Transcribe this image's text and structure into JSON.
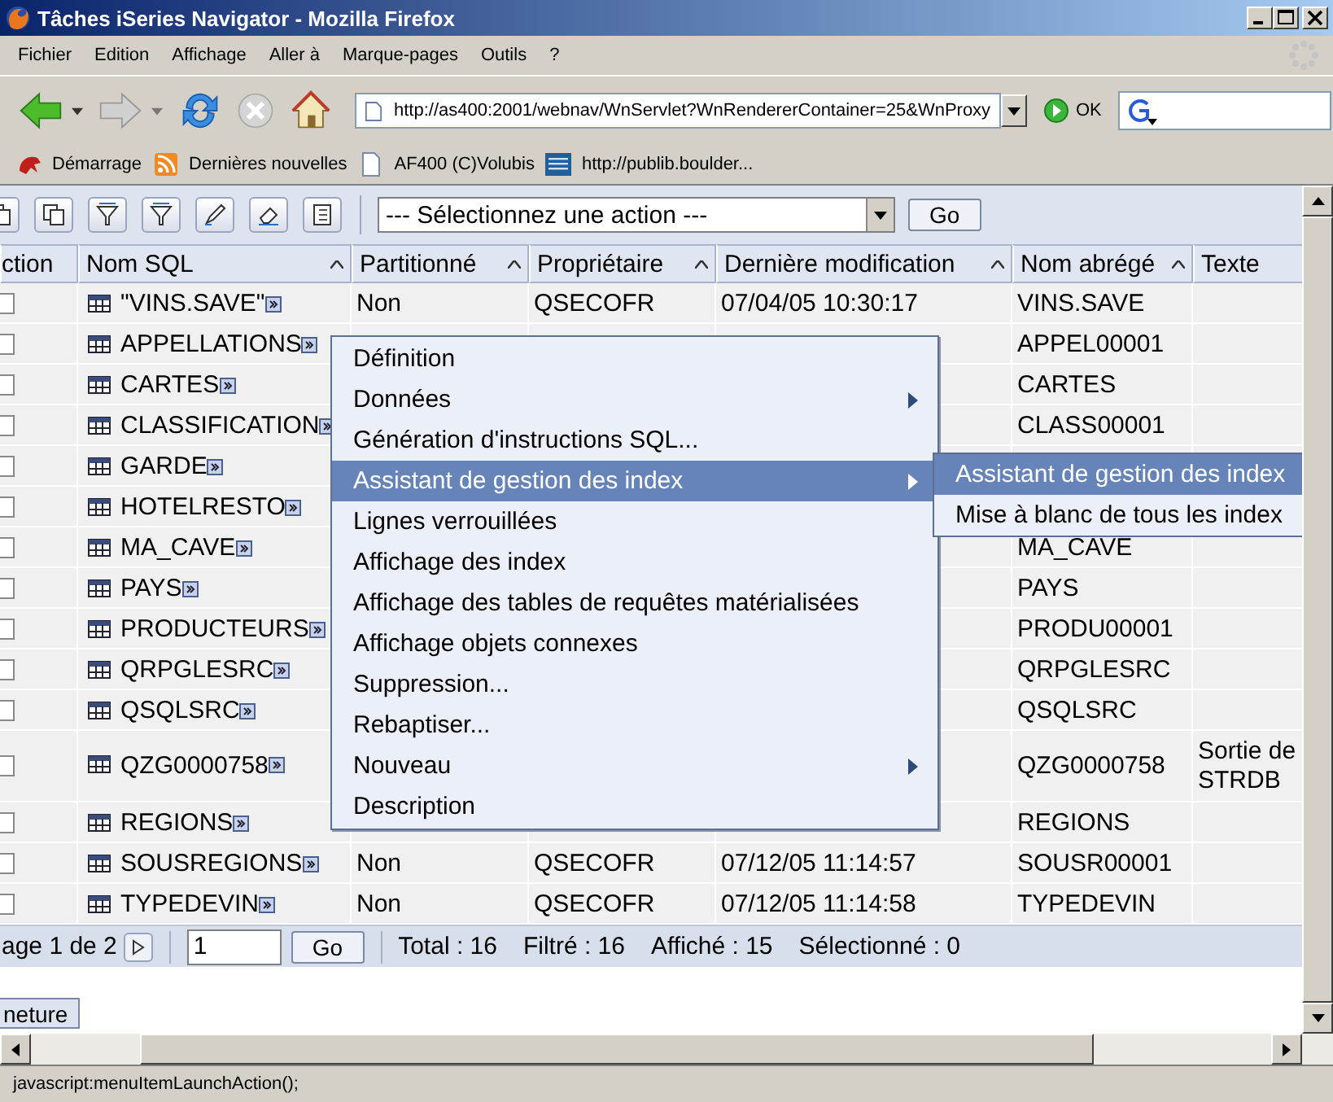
{
  "window": {
    "title": "Tâches iSeries Navigator - Mozilla Firefox"
  },
  "menu_bar": [
    "Fichier",
    "Edition",
    "Affichage",
    "Aller à",
    "Marque-pages",
    "Outils",
    "?"
  ],
  "nav": {
    "url": "http://as400:2001/webnav/WnServlet?WnRendererContainer=25&WnProxy",
    "go": "OK"
  },
  "bookmarks": [
    {
      "kind": "dragon",
      "label": "Démarrage"
    },
    {
      "kind": "rss",
      "label": "Dernières nouvelles"
    },
    {
      "kind": "page",
      "label": "AF400 (C)Volubis"
    },
    {
      "kind": "ibm",
      "label": "http://publib.boulder..."
    }
  ],
  "toolbar": {
    "action_select": "--- Sélectionnez une action ---",
    "go": "Go"
  },
  "table": {
    "columns": [
      {
        "label": "ction",
        "sortable": false
      },
      {
        "label": "Nom SQL",
        "sortable": true
      },
      {
        "label": "Partitionné",
        "sortable": true
      },
      {
        "label": "Propriétaire",
        "sortable": true
      },
      {
        "label": "Dernière modification",
        "sortable": true
      },
      {
        "label": "Nom abrégé",
        "sortable": true
      },
      {
        "label": "Texte",
        "sortable": false
      }
    ],
    "rows": [
      {
        "checked": false,
        "name": "\"VINS.SAVE\"",
        "partitioned": "Non",
        "owner": "QSECOFR",
        "modified": "07/04/05 10:30:17",
        "short_name": "VINS.SAVE"
      },
      {
        "checked": false,
        "name": "APPELLATIONS",
        "short_name": "APPEL00001"
      },
      {
        "checked": false,
        "name": "CARTES",
        "short_name": "CARTES"
      },
      {
        "checked": false,
        "name": "CLASSIFICATION",
        "short_name": "CLASS00001"
      },
      {
        "checked": false,
        "name": "GARDE"
      },
      {
        "checked": false,
        "name": "HOTELRESTO"
      },
      {
        "checked": false,
        "name": "MA_CAVE",
        "short_name": "MA_CAVE"
      },
      {
        "checked": false,
        "name": "PAYS",
        "short_name": "PAYS"
      },
      {
        "checked": false,
        "name": "PRODUCTEURS",
        "short_name": "PRODU00001"
      },
      {
        "checked": false,
        "name": "QRPGLESRC",
        "short_name": "QRPGLESRC"
      },
      {
        "checked": false,
        "name": "QSQLSRC",
        "short_name": "QSQLSRC"
      },
      {
        "checked": false,
        "name": "QZG0000758",
        "short_name": "QZG0000758",
        "text": "Sortie de STRDB"
      },
      {
        "checked": false,
        "name": "REGIONS",
        "short_name": "REGIONS"
      },
      {
        "checked": false,
        "name": "SOUSREGIONS",
        "partitioned": "Non",
        "owner": "QSECOFR",
        "modified": "07/12/05 11:14:57",
        "short_name": "SOUSR00001"
      },
      {
        "checked": false,
        "name": "TYPEDEVIN",
        "partitioned": "Non",
        "owner": "QSECOFR",
        "modified": "07/12/05 11:14:58",
        "short_name": "TYPEDEVIN"
      }
    ]
  },
  "pager": {
    "label": "age 1 de 2",
    "page": "1",
    "go": "Go",
    "stats": [
      "Total : 16",
      "Filtré : 16",
      "Affiché : 15",
      "Sélectionné : 0"
    ]
  },
  "close_button": "neture",
  "context_menu": [
    {
      "label": "Définition",
      "has_submenu": false,
      "selected": false
    },
    {
      "label": "Données",
      "has_submenu": true,
      "selected": false
    },
    {
      "label": "Génération d'instructions SQL...",
      "has_submenu": false,
      "selected": false
    },
    {
      "label": "Assistant de gestion des index",
      "has_submenu": true,
      "selected": true
    },
    {
      "label": "Lignes verrouillées",
      "has_submenu": false,
      "selected": false
    },
    {
      "label": "Affichage des index",
      "has_submenu": false,
      "selected": false
    },
    {
      "label": "Affichage des tables de requêtes matérialisées",
      "has_submenu": false,
      "selected": false
    },
    {
      "label": "Affichage objets connexes",
      "has_submenu": false,
      "selected": false
    },
    {
      "label": "Suppression...",
      "has_submenu": false,
      "selected": false
    },
    {
      "label": "Rebaptiser...",
      "has_submenu": false,
      "selected": false
    },
    {
      "label": "Nouveau",
      "has_submenu": true,
      "selected": false
    },
    {
      "label": "Description",
      "has_submenu": false,
      "selected": false
    }
  ],
  "submenu": [
    {
      "label": "Assistant de gestion des index",
      "selected": true
    },
    {
      "label": "Mise à blanc de tous les index",
      "selected": false
    }
  ],
  "status_bar": "javascript:menuItemLaunchAction();"
}
